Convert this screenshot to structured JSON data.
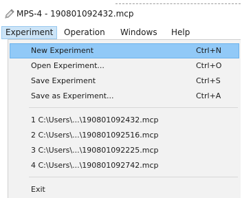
{
  "window": {
    "title": "MPS-4 - 190801092432.mcp",
    "icon": "pencil-icon"
  },
  "menubar": {
    "items": [
      {
        "label": "Experiment"
      },
      {
        "label": "Operation"
      },
      {
        "label": "Windows"
      },
      {
        "label": "Help"
      }
    ]
  },
  "experiment_menu": {
    "items": [
      {
        "label": "New  Experiment",
        "shortcut": "Ctrl+N"
      },
      {
        "label": "Open  Experiment...",
        "shortcut": "Ctrl+O"
      },
      {
        "label": "Save  Experiment",
        "shortcut": "Ctrl+S"
      },
      {
        "label": "Save as  Experiment...",
        "shortcut": "Ctrl+A"
      }
    ],
    "recent_files": [
      {
        "label": "1 C:\\Users\\...\\190801092432.mcp"
      },
      {
        "label": "2 C:\\Users\\...\\190801092516.mcp"
      },
      {
        "label": "3 C:\\Users\\...\\190801092225.mcp"
      },
      {
        "label": "4 C:\\Users\\...\\190801092742.mcp"
      }
    ],
    "exit_label": "Exit"
  },
  "colors": {
    "highlight": "#91c9f7",
    "menubar_active": "#cce4f7",
    "menu_background": "#f2f2f2"
  }
}
